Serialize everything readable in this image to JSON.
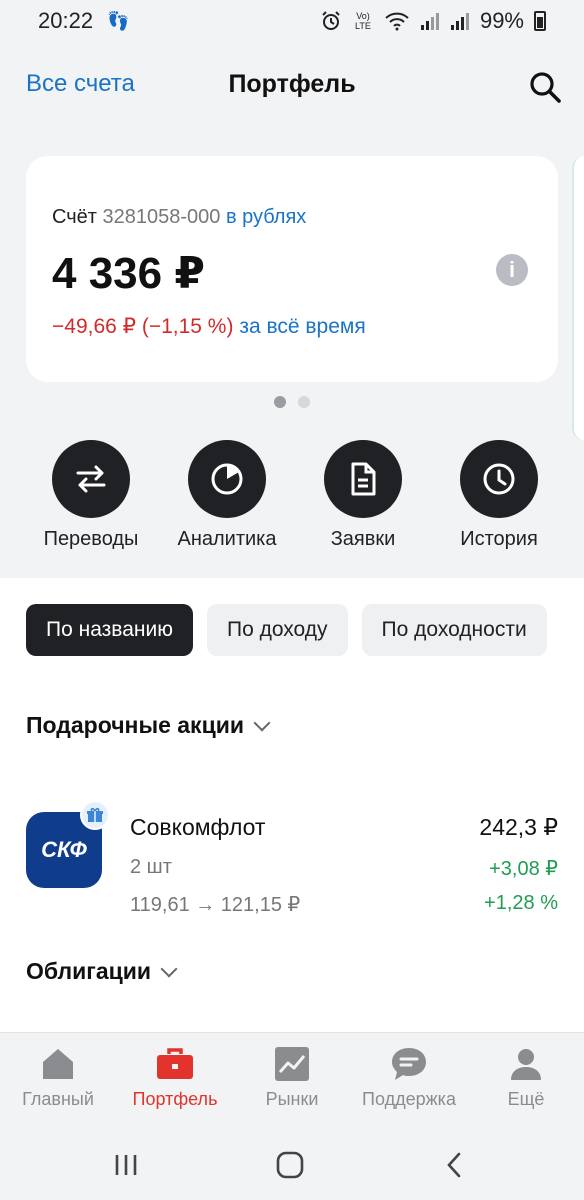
{
  "status_bar": {
    "time": "20:22",
    "battery": "99%",
    "lte": "Vo) LTE"
  },
  "header": {
    "all_accounts": "Все счета",
    "title": "Портфель"
  },
  "account_card": {
    "label": "Счёт",
    "number": "3281058-000",
    "currency": "в рублях",
    "balance": "4 336 ₽",
    "change": "−49,66 ₽ (−1,15 %)",
    "change_period": "за всё время",
    "info_icon": "i"
  },
  "carousel": {
    "pages": 2,
    "active": 0
  },
  "actions": [
    {
      "label": "Переводы",
      "icon": "transfer-icon"
    },
    {
      "label": "Аналитика",
      "icon": "pie-chart-icon"
    },
    {
      "label": "Заявки",
      "icon": "document-icon"
    },
    {
      "label": "История",
      "icon": "clock-icon"
    }
  ],
  "sort_chips": [
    {
      "label": "По названию",
      "active": true
    },
    {
      "label": "По доходу",
      "active": false
    },
    {
      "label": "По доходности",
      "active": false
    }
  ],
  "sections": [
    {
      "title": "Подарочные акции"
    },
    {
      "title": "Облигации"
    }
  ],
  "holding": {
    "logo_text": "СКФ",
    "name": "Совкомфлот",
    "quantity": "2 шт",
    "price_range": "119,61 → 121,15 ₽",
    "value": "242,3 ₽",
    "change_abs": "+3,08 ₽",
    "change_pct": "+1,28 %"
  },
  "bottom_nav": [
    {
      "label": "Главный",
      "icon": "home-icon",
      "active": false
    },
    {
      "label": "Портфель",
      "icon": "briefcase-icon",
      "active": true
    },
    {
      "label": "Рынки",
      "icon": "chart-icon",
      "active": false
    },
    {
      "label": "Поддержка",
      "icon": "chat-icon",
      "active": false
    },
    {
      "label": "Ещё",
      "icon": "profile-icon",
      "active": false
    }
  ],
  "colors": {
    "accent_blue": "#1a73c6",
    "negative_red": "#d22b2b",
    "positive_green": "#1f9d55",
    "active_nav_red": "#e2342d",
    "dark_button": "#202124"
  }
}
